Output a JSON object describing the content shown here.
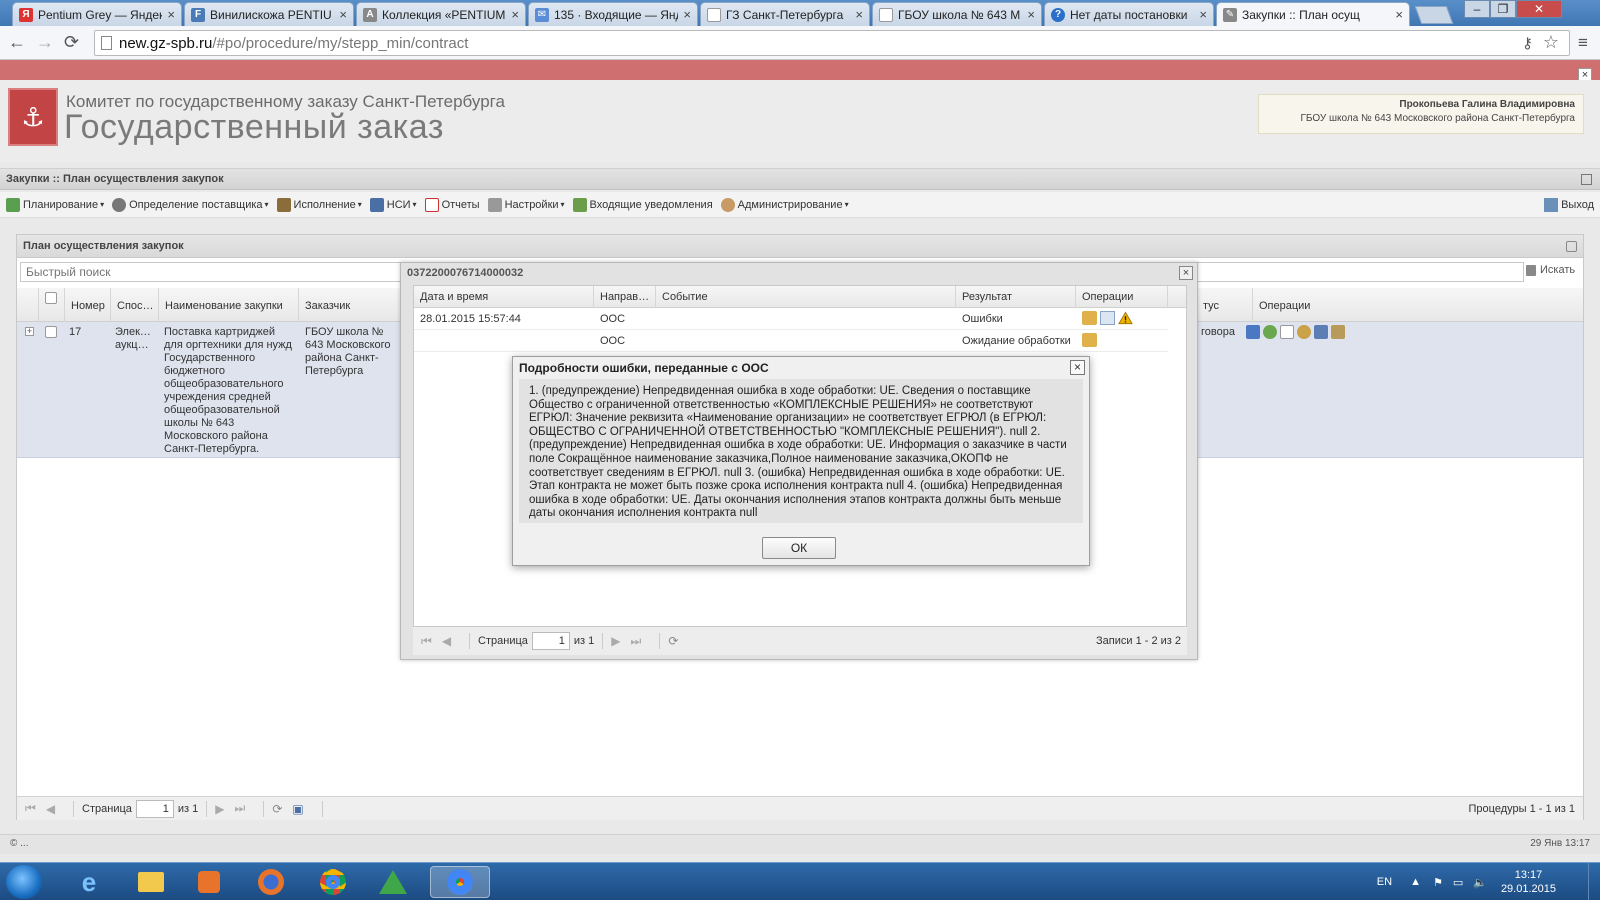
{
  "browser": {
    "tabs": [
      {
        "title": "Pentium Grey — Яндек",
        "icon_color": "#d33",
        "icon": "Я"
      },
      {
        "title": "Винилискожа PENTIU",
        "icon_color": "#4a7bb7",
        "icon": "F"
      },
      {
        "title": "Коллекция «PENTIUM",
        "icon_color": "#888",
        "icon": "A"
      },
      {
        "title": "135 · Входящие — Янд",
        "icon_color": "#5b8dd6",
        "icon": "✉"
      },
      {
        "title": "ГЗ Санкт-Петербурга",
        "icon_color": "#e8e8e8",
        "icon": ""
      },
      {
        "title": "ГБОУ школа № 643 М",
        "icon_color": "#e8e8e8",
        "icon": ""
      },
      {
        "title": "Нет даты постановки",
        "icon_color": "#2a6fc9",
        "icon": "?"
      },
      {
        "title": "Закупки :: План осущ",
        "icon_color": "#888",
        "icon": "✎"
      }
    ],
    "url_host": "new.gz-spb.ru",
    "url_path": "/#po/procedure/my/stepp_min/contract"
  },
  "header": {
    "org_line1": "Комитет по государственному заказу Санкт-Петербурга",
    "org_line2": "Государственный заказ",
    "user_name": "Прокопьева Галина Владимировна",
    "user_org": "ГБОУ школа № 643 Московского района Санкт-Петербурга"
  },
  "section_title": "Закупки :: План осуществления закупок",
  "menu": {
    "items": [
      {
        "label": "Планирование",
        "caret": "▾",
        "icon_color": "#5a9e4f"
      },
      {
        "label": "Определение поставщика",
        "caret": "▾",
        "icon_color": "#777"
      },
      {
        "label": "Исполнение",
        "caret": "▾",
        "icon_color": "#8a6d3b"
      },
      {
        "label": "НСИ",
        "caret": "▾",
        "icon_color": "#4a6fa5"
      },
      {
        "label": "Отчеты",
        "caret": "",
        "icon_color": "#c33"
      },
      {
        "label": "Настройки",
        "caret": "▾",
        "icon_color": "#888"
      },
      {
        "label": "Входящие уведомления",
        "caret": "",
        "icon_color": "#6a9e4a"
      },
      {
        "label": "Администрирование",
        "caret": "▾",
        "icon_color": "#c79a66"
      }
    ],
    "logout": "Выход"
  },
  "main_panel": {
    "title": "План осуществления закупок",
    "search_placeholder": "Быстрый поиск",
    "search_button": "Искать",
    "columns": {
      "number": "Номер",
      "method": "Спос…",
      "name": "Наименование закупки",
      "customer": "Заказчик",
      "status": "тус",
      "operations": "Операции"
    },
    "row": {
      "number": "17",
      "method": "Элек… аукц…",
      "name": "Поставка картриджей для оргтехники для нужд Государственного бюджетного общеобразовательного учреждения средней общеобразовательной школы № 643 Московского района Санкт-Петербурга.",
      "customer": "ГБОУ школа № 643 Московского района Санкт-Петербурга",
      "status": "говора"
    },
    "pager": {
      "page_label": "Страница",
      "page_value": "1",
      "of_label": "из 1",
      "summary": "Процедуры 1 - 1 из 1"
    }
  },
  "event_window": {
    "title": "0372200076714000032",
    "columns": {
      "datetime": "Дата и время",
      "direction": "Направ…",
      "event": "Событие",
      "result": "Результат",
      "operations": "Операции"
    },
    "rows": [
      {
        "datetime": "28.01.2015 15:57:44",
        "direction": "ООС",
        "event": "",
        "result": "Ошибки"
      },
      {
        "datetime": "",
        "direction": "ООС",
        "event": "",
        "result": "Ожидание обработки"
      }
    ],
    "pager": {
      "page_label": "Страница",
      "page_value": "1",
      "of_label": "из 1",
      "summary": "Записи 1 - 2 из 2"
    }
  },
  "error_dialog": {
    "title": "Подробности ошибки, переданные с ООС",
    "message": "1. (предупреждение) Непредвиденная ошибка в ходе обработки: UE. Сведения о поставщике Общество с ограниченной ответственностью «КОМПЛЕКСНЫЕ РЕШЕНИЯ» не соответствуют ЕГРЮЛ: Значение реквизита «Наименование организации» не соответствует ЕГРЮЛ (в ЕГРЮЛ: ОБЩЕСТВО С ОГРАНИЧЕННОЙ ОТВЕТСТВЕННОСТЬЮ \"КОМПЛЕКСНЫЕ РЕШЕНИЯ\"). null 2. (предупреждение) Непредвиденная ошибка в ходе обработки: UE. Информация о заказчике в части поле Сокращённое наименование заказчика,Полное наименование заказчика,ОКОПФ не соответствует сведениям в ЕГРЮЛ. null 3. (ошибка) Непредвиденная ошибка в ходе обработки: UE. Этап контракта не может быть позже срока исполнения контракта null 4. (ошибка) Непредвиденная ошибка в ходе обработки: UE. Даты окончания исполнения этапов контракта должны быть меньше даты окончания исполнения контракта null",
    "ok_label": "ОК"
  },
  "statusbar": {
    "left": "© ...",
    "right": "29 Янв 13:17"
  },
  "taskbar": {
    "lang": "EN",
    "time": "13:17",
    "date": "29.01.2015"
  }
}
